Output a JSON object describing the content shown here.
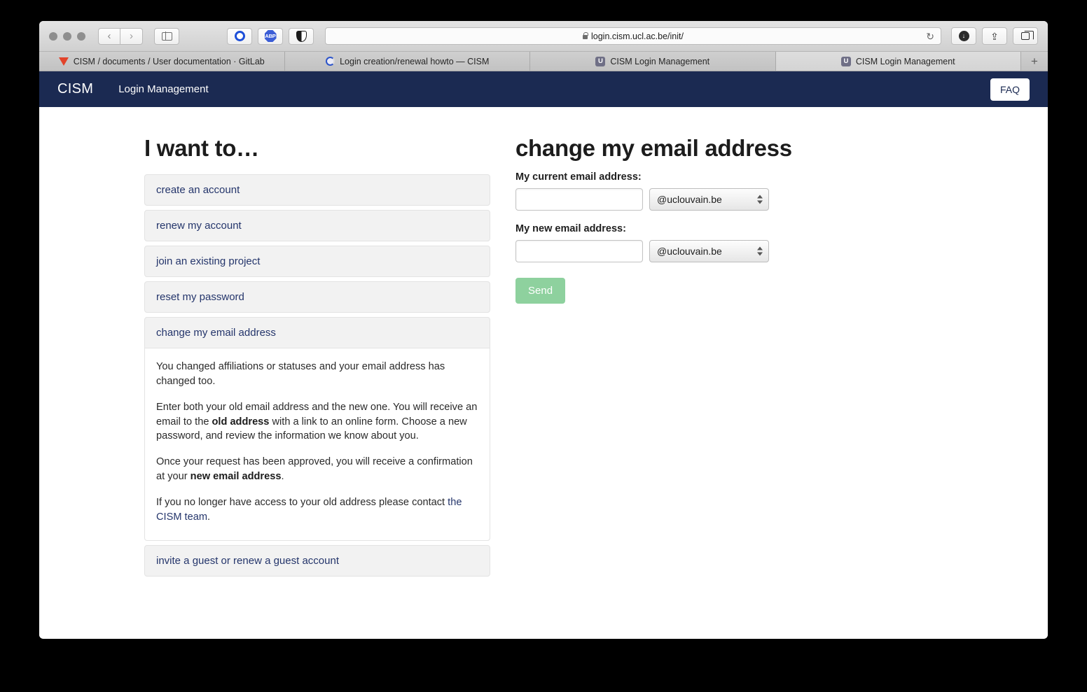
{
  "browser": {
    "url": "login.cism.ucl.ac.be/init/",
    "lock_icon": "lock-icon",
    "reload_icon": "↻",
    "back_icon": "‹",
    "forward_icon": "›",
    "sidebar_icon": "sidebar-icon",
    "download_icon": "↓",
    "share_icon": "⇪",
    "tab_overview_icon": "tabs-icon",
    "new_tab_icon": "+",
    "extensions": [
      {
        "name": "ublock-origin-icon",
        "label": ""
      },
      {
        "name": "adblock-plus-icon",
        "label": "ABP"
      },
      {
        "name": "dark-reader-icon",
        "label": ""
      }
    ],
    "tabs": [
      {
        "title": "CISM / documents / User documentation · GitLab",
        "favicon": "gitlab-favicon",
        "active": false
      },
      {
        "title": "Login creation/renewal howto — CISM",
        "favicon": "cism-favicon",
        "active": false
      },
      {
        "title": "CISM Login Management",
        "favicon": "ucl-favicon",
        "favicon_letter": "U",
        "active": false
      },
      {
        "title": "CISM Login Management",
        "favicon": "ucl-favicon",
        "favicon_letter": "U",
        "active": true
      }
    ]
  },
  "navbar": {
    "brand": "CISM",
    "link": "Login Management",
    "faq_label": "FAQ",
    "background": "#1b2a52"
  },
  "left": {
    "heading": "I want to…",
    "options": [
      {
        "label": "create an account"
      },
      {
        "label": "renew my account"
      },
      {
        "label": "join an existing project"
      },
      {
        "label": "reset my password"
      },
      {
        "label": "change my email address"
      },
      {
        "label": "invite a guest or renew a guest account"
      }
    ],
    "panel": {
      "p1": "You changed affiliations or statuses and your email address has changed too.",
      "p2_a": "Enter both your old email address and the new one. You will receive an email to the ",
      "p2_b": "old address",
      "p2_c": " with a link to an online form. Choose a new password, and review the information we know about you.",
      "p3_a": "Once your request has been approved, you will receive a confirmation at your ",
      "p3_b": "new email address",
      "p3_c": ".",
      "p4_a": "If you no longer have access to your old address please contact ",
      "p4_link": "the CISM team",
      "p4_b": "."
    }
  },
  "right": {
    "heading": "change my email address",
    "current_label": "My current email address:",
    "current_value": "",
    "current_domain": "@uclouvain.be",
    "new_label": "My new email address:",
    "new_value": "",
    "new_domain": "@uclouvain.be",
    "send_label": "Send",
    "send_color": "#8ed19e"
  }
}
